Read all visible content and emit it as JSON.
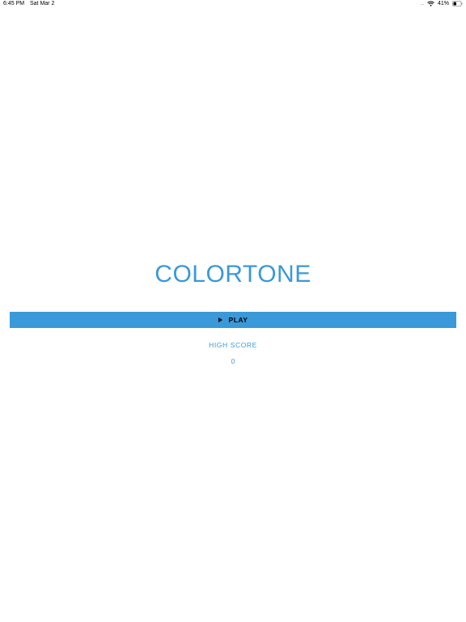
{
  "status_bar": {
    "time": "6:45 PM",
    "date": "Sat Mar 2",
    "signal": "....",
    "battery_percent": "41%",
    "battery_level": 0.41,
    "icons": [
      "wifi-icon",
      "battery-icon"
    ]
  },
  "game": {
    "title": "COLORTONE",
    "play_label": "PLAY",
    "play_icon": "play-icon",
    "high_score_label": "HIGH SCORE",
    "high_score_value": "0"
  },
  "colors": {
    "accent": "#3a99d8",
    "background": "#ffffff",
    "text_dark": "#000000"
  }
}
